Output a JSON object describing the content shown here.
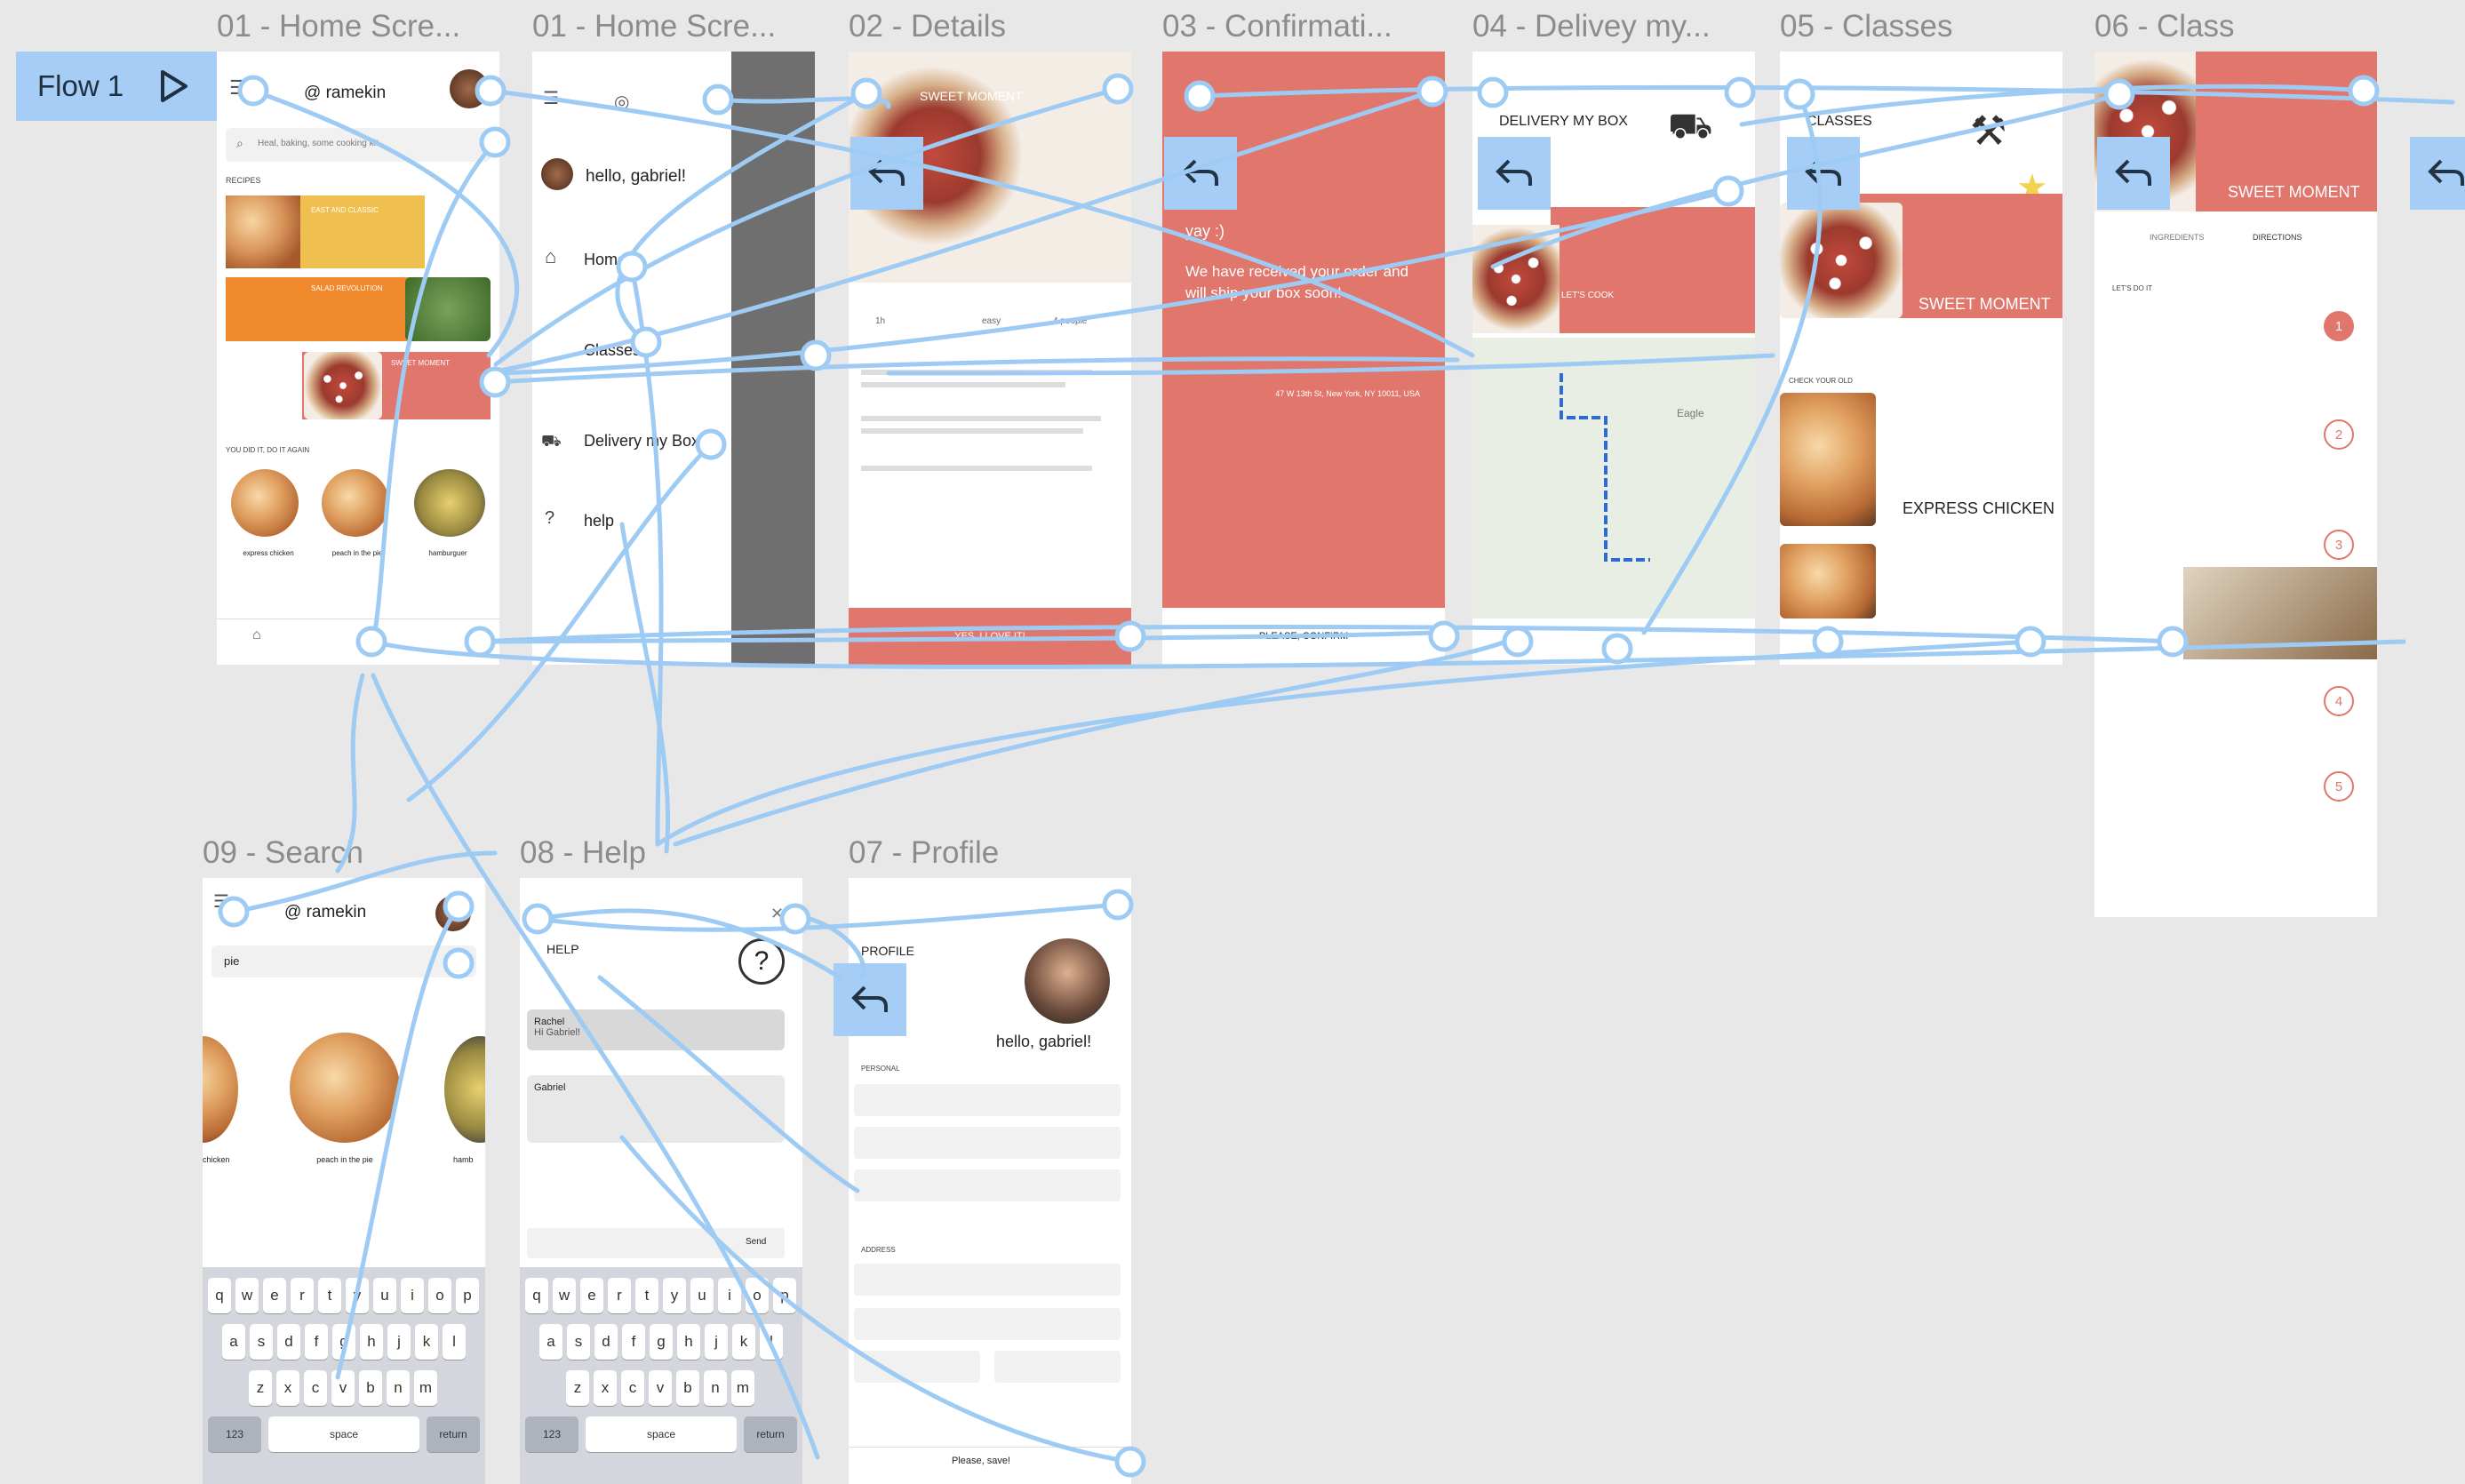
{
  "flow": {
    "label": "Flow 1",
    "play_icon": "play-icon"
  },
  "frames": [
    {
      "id": "home1",
      "title": "01 - Home Scre..."
    },
    {
      "id": "home2",
      "title": "01 - Home Scre..."
    },
    {
      "id": "details",
      "title": "02 - Details"
    },
    {
      "id": "confirm",
      "title": "03 - Confirmati..."
    },
    {
      "id": "delivery",
      "title": "04 - Delivey my..."
    },
    {
      "id": "classes",
      "title": "05 - Classes"
    },
    {
      "id": "class",
      "title": "06 - Class"
    },
    {
      "id": "search",
      "title": "09 - Search"
    },
    {
      "id": "help",
      "title": "08 - Help"
    },
    {
      "id": "profile",
      "title": "07 - Profile"
    }
  ],
  "home": {
    "brand": "@ ramekin",
    "search_placeholder": "Heal, baking, some cooking kit",
    "recipes_heading": "RECIPES",
    "cards": [
      "EAST AND CLASSIC",
      "SALAD REVOLUTION",
      "SWEET MOMENT"
    ],
    "you_did_it": "YOU DID IT, DO IT AGAIN",
    "items": [
      "express chicken",
      "peach in the pie",
      "hamburguer"
    ]
  },
  "menu": {
    "greeting": "hello, gabriel!",
    "items": [
      "Home",
      "Classes",
      "Delivery my Box",
      "help"
    ]
  },
  "details": {
    "title": "SWEET MOMENT",
    "stats": [
      "1h",
      "easy",
      "4 people"
    ],
    "button": "YES, I LOVE IT!"
  },
  "confirm": {
    "yay": "yay :)",
    "message": "We have received your order and will ship your box soon!",
    "address": "47 W 13th St, New York, NY 10011, USA",
    "button": "PLEASE, CONFIRM"
  },
  "delivery": {
    "title": "DELIVERY MY BOX",
    "cta": "LET'S COOK",
    "map_label": "Eagle"
  },
  "classes": {
    "title": "CLASSES",
    "card1": "SWEET MOMENT",
    "section": "CHECK YOUR OLD",
    "card2": "EXPRESS CHICKEN"
  },
  "class": {
    "title": "SWEET MOMENT",
    "tabs": [
      "INGREDIENTS",
      "DIRECTIONS"
    ],
    "lets_do": "LET'S DO IT",
    "steps": [
      "1",
      "2",
      "3",
      "4",
      "5"
    ]
  },
  "search": {
    "brand": "@ ramekin",
    "query": "pie",
    "items": [
      "chicken",
      "peach in the pie",
      "hamb"
    ]
  },
  "help": {
    "title": "HELP",
    "msg1_name": "Rachel",
    "msg1_text": "Hi Gabriel!",
    "msg2_name": "Gabriel",
    "send": "Send"
  },
  "profile": {
    "title": "PROFILE",
    "greeting": "hello, gabriel!",
    "personal": "PERSONAL",
    "address": "ADDRESS",
    "save": "Please, save!"
  },
  "keyboard": {
    "row1": [
      "q",
      "w",
      "e",
      "r",
      "t",
      "y",
      "u",
      "i",
      "o",
      "p"
    ],
    "row2": [
      "a",
      "s",
      "d",
      "f",
      "g",
      "h",
      "j",
      "k",
      "l"
    ],
    "row3": [
      "z",
      "x",
      "c",
      "v",
      "b",
      "n",
      "m"
    ],
    "num": "123",
    "space": "space",
    "ret": "return"
  },
  "colors": {
    "accent": "#e0766c",
    "wire": "#9ecbf3",
    "flow_bg": "#a5cdf5"
  }
}
